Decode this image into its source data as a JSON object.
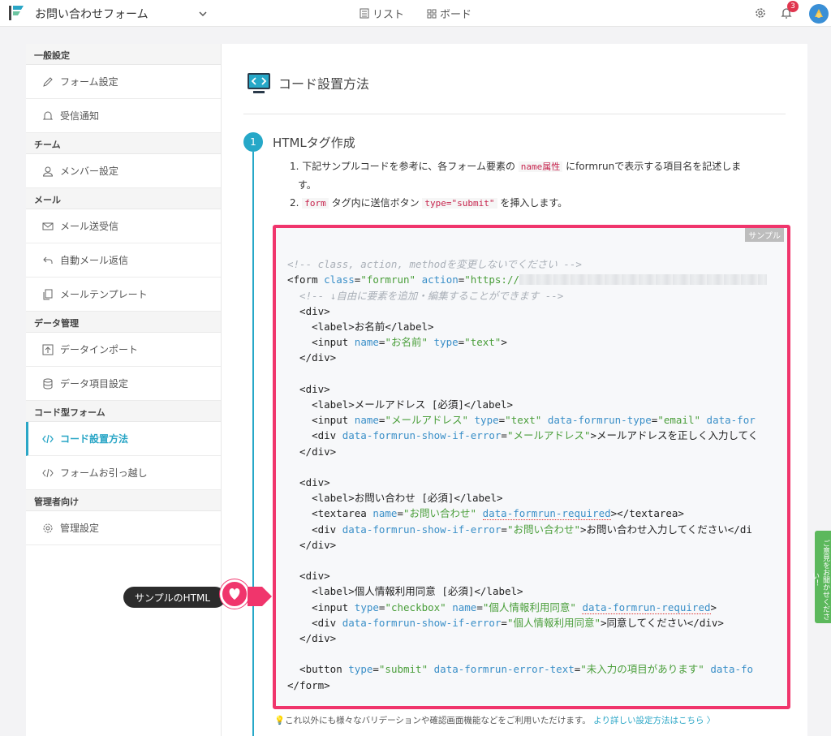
{
  "topbar": {
    "form_title": "お問い合わせフォーム",
    "nav_list": "リスト",
    "nav_board": "ボード",
    "notification_count": "3"
  },
  "sidebar": {
    "sections": [
      {
        "title": "一般設定",
        "items": [
          {
            "label": "フォーム設定",
            "icon": "pencil-icon"
          },
          {
            "label": "受信通知",
            "icon": "bell-icon"
          }
        ]
      },
      {
        "title": "チーム",
        "items": [
          {
            "label": "メンバー設定",
            "icon": "user-icon"
          }
        ]
      },
      {
        "title": "メール",
        "items": [
          {
            "label": "メール送受信",
            "icon": "mail-icon"
          },
          {
            "label": "自動メール返信",
            "icon": "reply-icon"
          },
          {
            "label": "メールテンプレート",
            "icon": "copy-icon"
          }
        ]
      },
      {
        "title": "データ管理",
        "items": [
          {
            "label": "データインポート",
            "icon": "upload-icon"
          },
          {
            "label": "データ項目設定",
            "icon": "database-icon"
          }
        ]
      },
      {
        "title": "コード型フォーム",
        "items": [
          {
            "label": "コード設置方法",
            "icon": "code-icon",
            "active": true
          },
          {
            "label": "フォームお引っ越し",
            "icon": "code-icon"
          }
        ]
      },
      {
        "title": "管理者向け",
        "items": [
          {
            "label": "管理設定",
            "icon": "gear-icon"
          }
        ]
      }
    ]
  },
  "main": {
    "page_title": "コード設置方法",
    "step_number": "1",
    "step_title": "HTMLタグ作成",
    "instruction1_pre": "1. 下記サンプルコードを参考に、各フォーム要素の ",
    "instruction1_code": "name属性",
    "instruction1_post": " にformrunで表示する項目名を記述しま",
    "instruction1_wrap": "す。",
    "instruction2_pre": "2. ",
    "instruction2_code1": "form",
    "instruction2_mid": " タグ内に送信ボタン ",
    "instruction2_code2": "type=\"submit\"",
    "instruction2_post": " を挿入します。",
    "sample_tag": "サンプル",
    "footnote_text": "💡これ以外にも様々なバリデーションや確認画面機能などをご利用いただけます。",
    "footnote_link": "より詳しい設定方法はこちら 〉"
  },
  "code": {
    "line01": "<!-- class, action, methodを変更しないでください -->",
    "line02_tag": "<form ",
    "line02_attr1": "class",
    "line02_val1": "\"formrun\"",
    "line02_attr2": "action",
    "line02_val2": "\"https://",
    "line03": "  <!-- ↓自由に要素を追加・編集することができます -->",
    "label_name": "お名前",
    "input_name_val": "\"お名前\"",
    "input_type_text": "\"text\"",
    "label_email": "メールアドレス [必須]",
    "input_email_name": "\"メールアドレス\"",
    "input_email_type": "\"email\"",
    "email_error_text": "メールアドレスを正しく入力してく",
    "label_inquiry": "お問い合わせ [必須]",
    "textarea_name": "\"お問い合わせ\"",
    "inquiry_error_text": "お問い合わせ入力してください</di",
    "label_privacy": "個人情報利用同意 [必須]",
    "input_checkbox": "\"checkbox\"",
    "privacy_name": "\"個人情報利用同意\"",
    "privacy_error_text": "同意してください</div>",
    "button_type": "\"submit\"",
    "button_error": "\"未入力の項目があります\"",
    "form_close": "</form>"
  },
  "overlay": {
    "tooltip_label": "サンプルのHTML",
    "feedback_label": "ご意見をお聞かせください！"
  },
  "colors": {
    "accent": "#26a8c8",
    "highlight_border": "#f0356c",
    "feedback_green": "#5cb85c"
  }
}
